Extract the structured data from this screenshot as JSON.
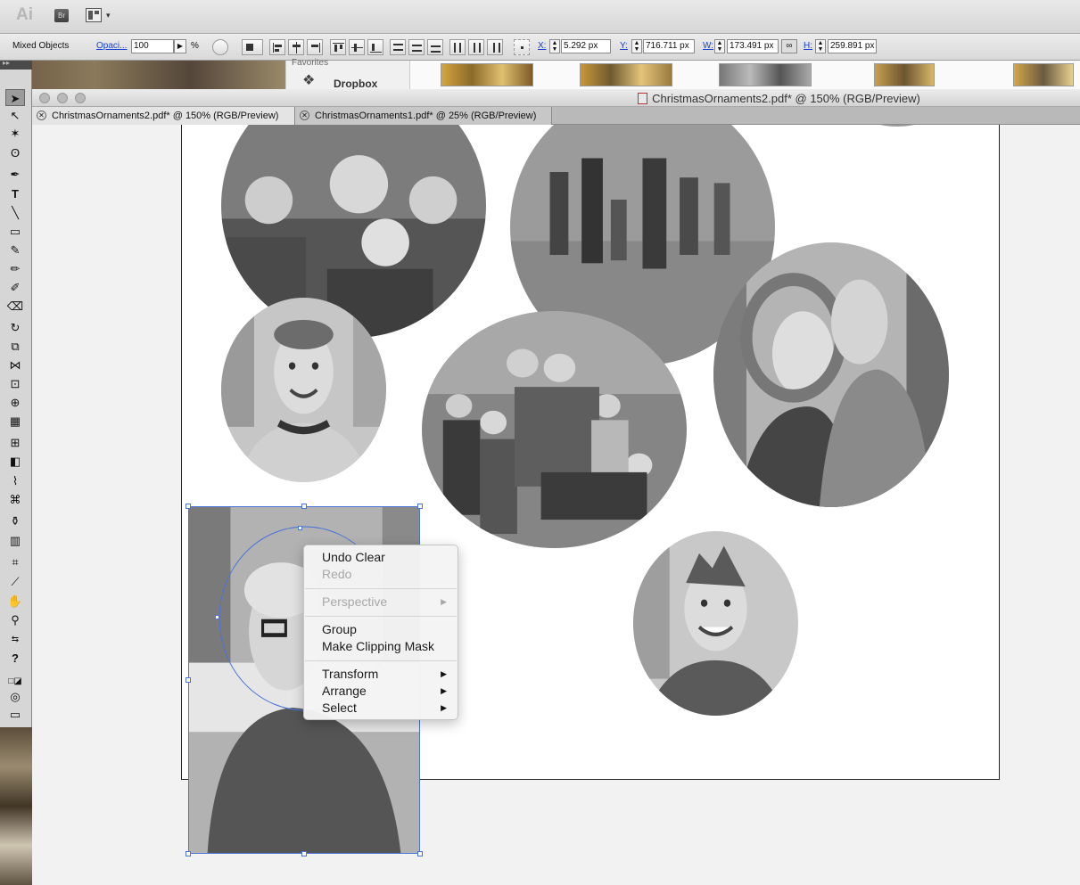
{
  "app": {
    "logo": "Ai",
    "bridge_label": "Br"
  },
  "control_bar": {
    "selection_label": "Mixed Objects",
    "opacity_label": "Opaci...",
    "opacity_value": "100",
    "opacity_unit": "%",
    "x_label": "X:",
    "x_value": "5.292 px",
    "y_label": "Y:",
    "y_value": "716.711 px",
    "w_label": "W:",
    "w_value": "173.491 px",
    "h_label": "H:",
    "h_value": "259.891 px"
  },
  "background": {
    "favorites_label": "Favorites",
    "dropbox_label": "Dropbox"
  },
  "document": {
    "window_title": "ChristmasOrnaments2.pdf* @ 150% (RGB/Preview)",
    "tabs": [
      {
        "label": "ChristmasOrnaments2.pdf* @ 150% (RGB/Preview)",
        "active": true
      },
      {
        "label": "ChristmasOrnaments1.pdf* @ 25% (RGB/Preview)",
        "active": false
      }
    ]
  },
  "context_menu": {
    "items": [
      {
        "label": "Undo Clear",
        "enabled": true
      },
      {
        "label": "Redo",
        "enabled": false
      },
      {
        "label": "Perspective",
        "enabled": false,
        "submenu": true
      },
      {
        "label": "Group",
        "enabled": true
      },
      {
        "label": "Make Clipping Mask",
        "enabled": true
      },
      {
        "label": "Transform",
        "enabled": true,
        "submenu": true
      },
      {
        "label": "Arrange",
        "enabled": true,
        "submenu": true
      },
      {
        "label": "Select",
        "enabled": true,
        "submenu": true
      }
    ]
  },
  "icons": {
    "submenu_arrow": "▶",
    "dropdown_caret": "▾"
  }
}
